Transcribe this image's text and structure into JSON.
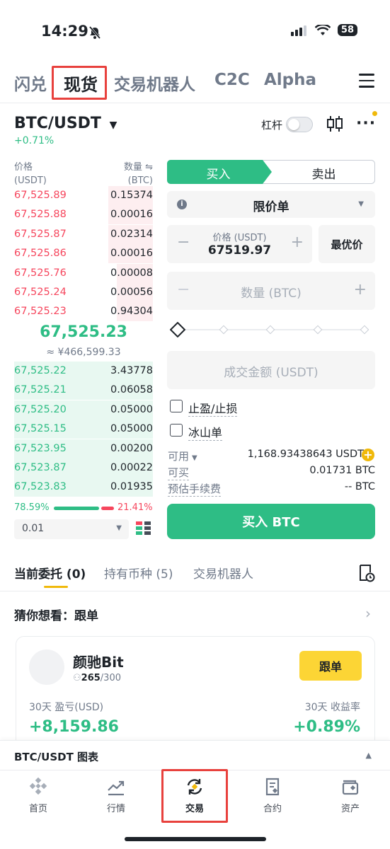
{
  "status_bar": {
    "time": "14:29",
    "battery": "58"
  },
  "top_nav": {
    "tabs": [
      "闪兑",
      "现货",
      "交易机器人",
      "C2C",
      "Alpha"
    ],
    "active": "现货"
  },
  "pair": {
    "symbol": "BTC/USDT",
    "change": "+0.71%",
    "leverage_label": "杠杆"
  },
  "orderbook": {
    "price_header": "价格",
    "price_unit": "(USDT)",
    "qty_header": "数量",
    "qty_unit": "(BTC)",
    "asks": [
      {
        "price": "67,525.89",
        "qty": "0.15374",
        "depth": 0.32
      },
      {
        "price": "67,525.88",
        "qty": "0.00016",
        "depth": 0.32
      },
      {
        "price": "67,525.87",
        "qty": "0.02314",
        "depth": 0.32
      },
      {
        "price": "67,525.86",
        "qty": "0.00016",
        "depth": 0.32
      },
      {
        "price": "67,525.76",
        "qty": "0.00008",
        "depth": 0.26
      },
      {
        "price": "67,525.24",
        "qty": "0.00056",
        "depth": 0.26
      },
      {
        "price": "67,525.23",
        "qty": "0.94304",
        "depth": 0.26
      }
    ],
    "last_price": "67,525.23",
    "last_price_cny": "≈ ¥466,599.33",
    "bids": [
      {
        "price": "67,525.22",
        "qty": "3.43778",
        "depth": 1.0
      },
      {
        "price": "67,525.21",
        "qty": "0.06058",
        "depth": 1.0
      },
      {
        "price": "67,525.20",
        "qty": "0.05000",
        "depth": 1.0
      },
      {
        "price": "67,525.15",
        "qty": "0.05000",
        "depth": 1.0
      },
      {
        "price": "67,523.95",
        "qty": "0.00200",
        "depth": 1.0
      },
      {
        "price": "67,523.87",
        "qty": "0.00022",
        "depth": 1.0
      },
      {
        "price": "67,523.83",
        "qty": "0.01935",
        "depth": 1.0
      }
    ],
    "buy_ratio": "78.59%",
    "sell_ratio": "21.41%",
    "precision": "0.01"
  },
  "order_form": {
    "buy_tab": "买入",
    "sell_tab": "卖出",
    "order_type": "限价单",
    "price_label": "价格 (USDT)",
    "price_value": "67519.97",
    "best_price": "最优价",
    "qty_placeholder": "数量 (BTC)",
    "amount_placeholder": "成交金额 (USDT)",
    "tp_sl": "止盈/止损",
    "iceberg": "冰山单",
    "available_label": "可用",
    "available_value": "1,168.93438643 USDT",
    "can_buy_label": "可买",
    "can_buy_value": "0.01731 BTC",
    "fee_label": "预估手续费",
    "fee_value": "-- BTC",
    "submit": "买入 BTC"
  },
  "bottom_tabs": {
    "open_orders": "当前委托 (0)",
    "holdings": "持有币种 (5)",
    "bots": "交易机器人"
  },
  "guess": {
    "title": "猜你想看：跟单"
  },
  "copy_card": {
    "name": "颜驰Bit",
    "followers": "265",
    "followers_max": "/300",
    "follow_btn": "跟单",
    "pnl_label": "30天 盈亏(USD)",
    "pnl_value": "+8,159.86",
    "roi_label": "30天 收益率",
    "roi_value": "+0.89%"
  },
  "chart_bar": {
    "label": "BTC/USDT 图表"
  },
  "bottom_nav": [
    "首页",
    "行情",
    "交易",
    "合约",
    "资产"
  ],
  "colors": {
    "green": "#2ebd85",
    "red": "#f6465d",
    "yellow": "#fcd535",
    "highlight": "#e8413d"
  }
}
